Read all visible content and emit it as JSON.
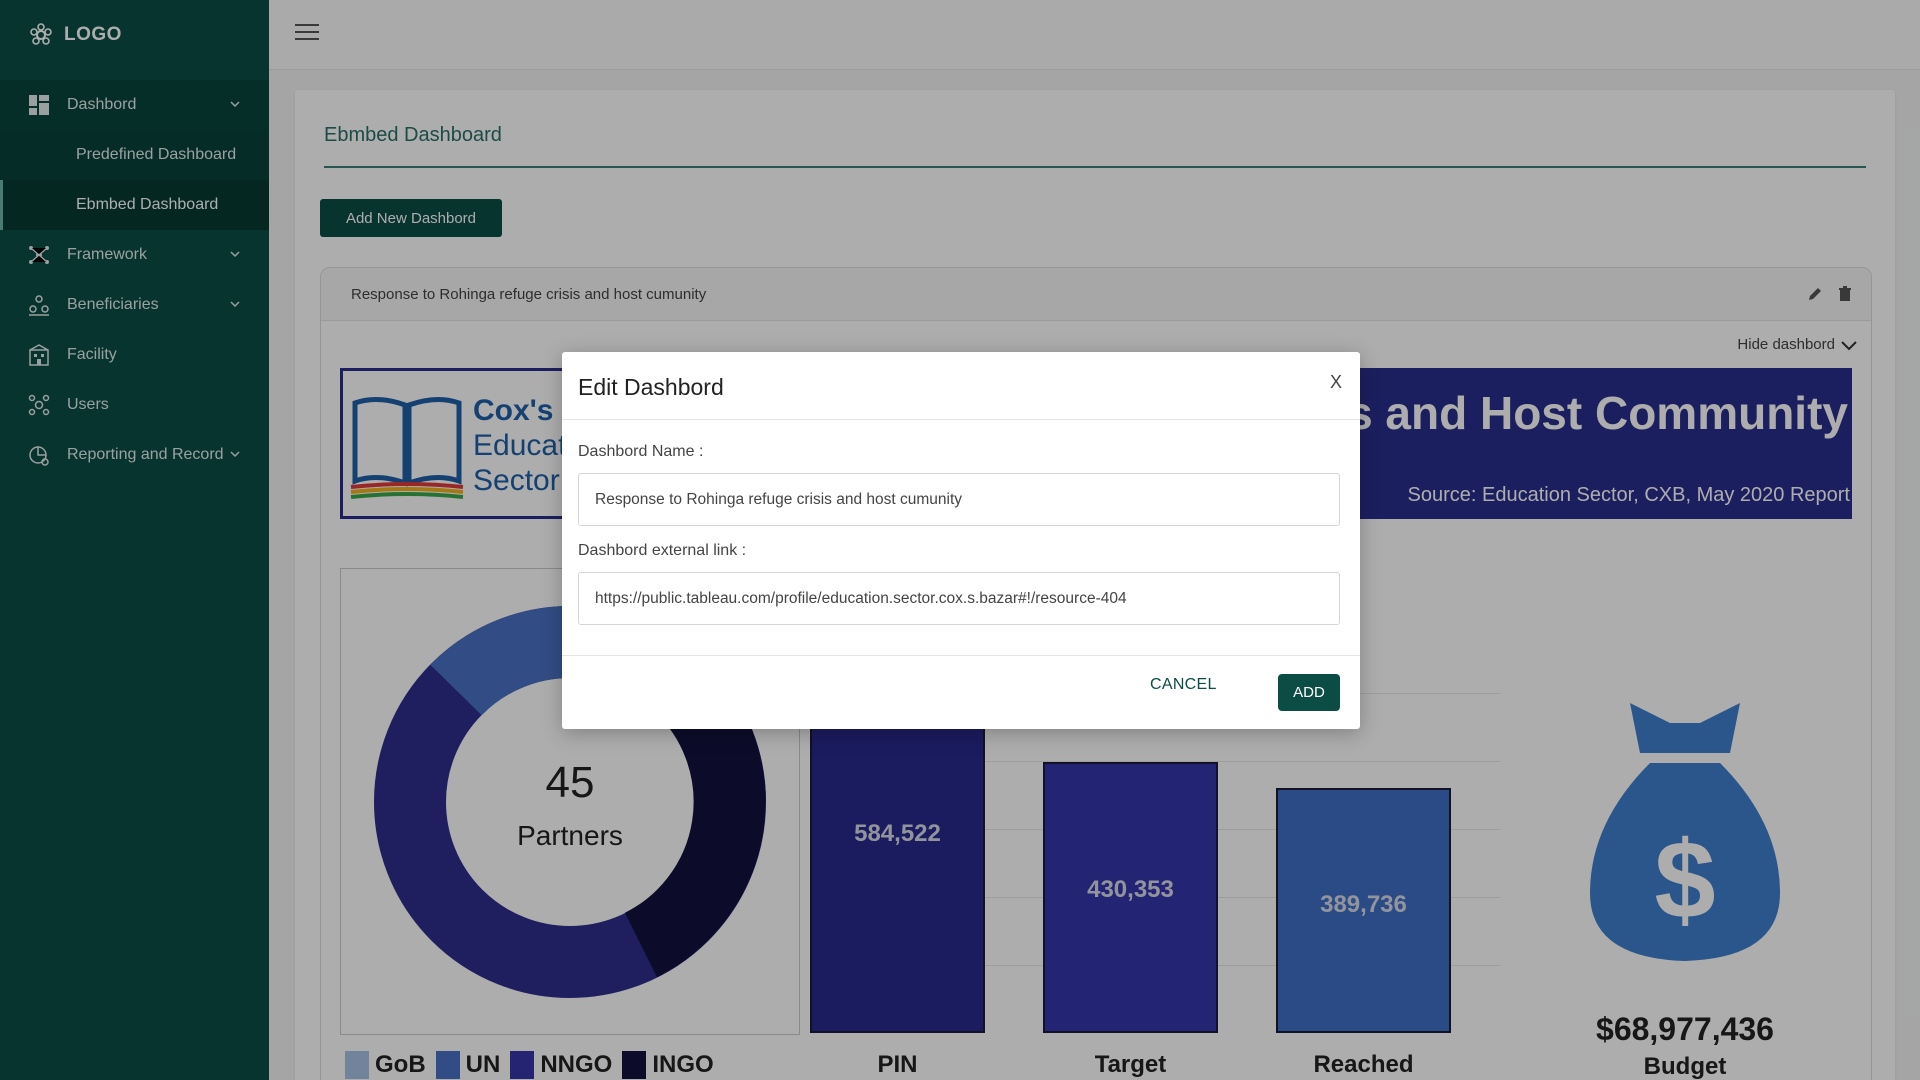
{
  "sidebar": {
    "logo": "LOGO",
    "items": [
      {
        "label": "Dashbord",
        "icon": "dashboard-icon"
      },
      {
        "label": "Predefined Dashboard"
      },
      {
        "label": "Ebmbed Dashboard"
      },
      {
        "label": "Framework",
        "icon": "framework-icon"
      },
      {
        "label": "Beneficiaries",
        "icon": "beneficiaries-icon"
      },
      {
        "label": "Facility",
        "icon": "facility-icon"
      },
      {
        "label": "Users",
        "icon": "users-icon"
      },
      {
        "label": "Reporting and Record",
        "icon": "reporting-icon"
      }
    ]
  },
  "main": {
    "title": "Ebmbed Dashboard",
    "add_button": "Add New Dashbord",
    "panel_title": "Response to Rohinga refuge crisis and host cumunity",
    "hide_dashboard": "Hide dashbord"
  },
  "embed": {
    "logo_text_1": "Cox's B",
    "logo_text_2": "Educati",
    "logo_text_3": "Sector",
    "banner_title": "sis and Host Community",
    "banner_source": "Source: Education Sector, CXB, May 2020 Report",
    "donut_value": "45",
    "donut_label": "Partners",
    "legend": [
      {
        "label": "GoB",
        "color": "#a9c1e6"
      },
      {
        "label": "UN",
        "color": "#4a72c4"
      },
      {
        "label": "NNGO",
        "color": "#3535a8"
      },
      {
        "label": "INGO",
        "color": "#12123f"
      }
    ],
    "bars": [
      {
        "label": "PIN",
        "value": 584522,
        "display": "584,522",
        "color": "#28288e"
      },
      {
        "label": "Target",
        "value": 430353,
        "display": "430,353",
        "color": "#3535ad"
      },
      {
        "label": "Reached",
        "value": 389736,
        "display": "389,736",
        "color": "#3f6fc6"
      }
    ],
    "budget_value": "$68,977,436",
    "budget_label": "Budget",
    "colors": {
      "banner": "#2a2e8c",
      "money_bag": "#3f7fce"
    }
  },
  "modal": {
    "title": "Edit Dashbord",
    "close": "X",
    "name_label": "Dashbord Name :",
    "name_value": "Response to Rohinga refuge crisis and host cumunity",
    "link_label": "Dashbord external link :",
    "link_value": "https://public.tableau.com/profile/education.sector.cox.s.bazar#!/resource-404",
    "cancel": "CANCEL",
    "add": "ADD"
  },
  "colors": {
    "brand": "#0b4d45",
    "accent_text": "#2b6f66"
  }
}
